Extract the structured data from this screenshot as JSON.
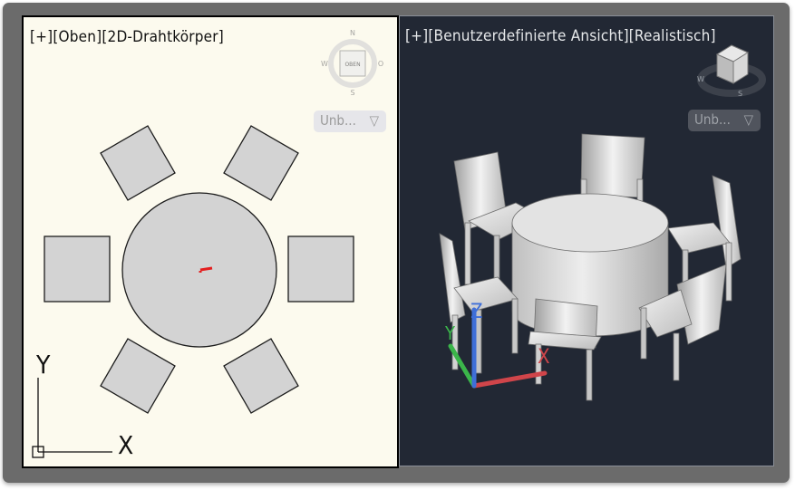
{
  "viewports": {
    "left": {
      "label": "[+][Oben][2D-Drahtkörper]",
      "viewcube": {
        "face": "OBEN",
        "north": "N",
        "south": "S",
        "east": "O",
        "west": "W"
      },
      "ucs_menu": "Unb...",
      "axes": {
        "x": "X",
        "y": "Y"
      }
    },
    "right": {
      "label": "[+][Benutzerdefinierte Ansicht][Realistisch]",
      "viewcube": {
        "west": "W",
        "south": "S"
      },
      "ucs_menu": "Unb...",
      "axes": {
        "x": "X",
        "y": "Y",
        "z": "Z"
      }
    }
  },
  "icons": {
    "caret": "chevron-down-icon",
    "viewcube": "viewcube-icon",
    "ucs": "ucs-axis-icon"
  },
  "colors": {
    "left_background": "#fcfaee",
    "right_background": "#222834",
    "frame": "#6b6b6b",
    "furniture_fill": "#d3d3d3",
    "axis_x": "#d0454a",
    "axis_y": "#3bb54a",
    "axis_z": "#3f6fd8"
  }
}
